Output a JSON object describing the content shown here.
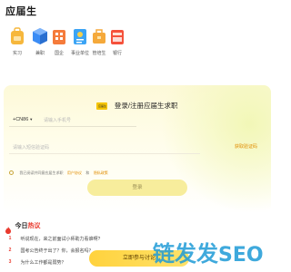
{
  "app": {
    "logo_text": "应届生"
  },
  "categories": [
    {
      "label": "实习",
      "icon": "backpack-icon",
      "color": "#f6b73c"
    },
    {
      "label": "兼职",
      "icon": "cube-icon",
      "color": "#3b8cf5"
    },
    {
      "label": "国企",
      "icon": "building-icon",
      "color": "#f57b3b"
    },
    {
      "label": "事业单位",
      "icon": "document-icon",
      "color": "#3ba4f5"
    },
    {
      "label": "管培生",
      "icon": "bag-icon",
      "color": "#f5a93b"
    },
    {
      "label": "银行",
      "icon": "bank-icon",
      "color": "#f5513b"
    }
  ],
  "register": {
    "badge_text": "应届生",
    "title": "登录/注册应届生求职",
    "country_code": "+CN86",
    "phone_placeholder": "请输入手机号",
    "code_placeholder": "请输入短信验证码",
    "get_code_label": "获取验证码",
    "agree_prefix": "我已阅读并同意应届生求职",
    "user_agreement": "用户协议",
    "agree_and": "和",
    "privacy_policy": "隐私政策",
    "submit_label": "登录"
  },
  "hot": {
    "title_prefix": "今日",
    "title_highlight": "热议",
    "items": [
      {
        "num": "1",
        "text": "听说现在，来之前面试小师助力看谁啊?"
      },
      {
        "num": "2",
        "text": "国考公告终于出了？你，会报名吗？"
      },
      {
        "num": "3",
        "text": "为什么工作都是弱势？"
      }
    ],
    "cta_label": "立即参与讨论"
  },
  "watermark": {
    "text": "链发发SEO"
  },
  "colors": {
    "accent": "#f5c400",
    "hot_red": "#e93a2e",
    "link_orange": "#e08c00"
  }
}
